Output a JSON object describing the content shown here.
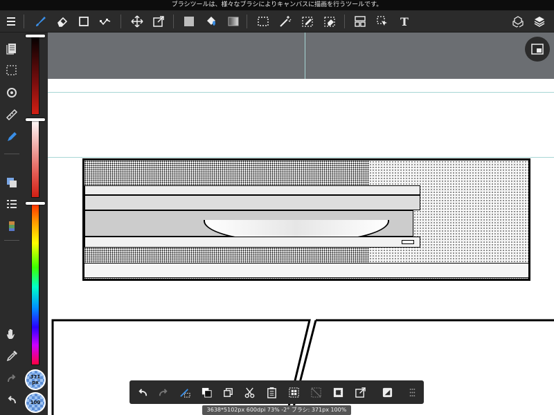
{
  "tip": "ブラシツールは、様々なブラシによりキャンバスに描画を行うツールです。",
  "toolbar": {
    "tools": [
      "menu-icon",
      "brush-icon",
      "eraser-icon",
      "shape-icon",
      "vector-icon",
      "move-icon",
      "transform-icon",
      "fill-color-icon",
      "bucket-icon",
      "gradient-icon",
      "select-rect-icon",
      "magic-wand-icon",
      "select-pen-icon",
      "select-eraser-icon",
      "panel-layout-icon",
      "select-move-icon",
      "text-icon",
      "3d-icon",
      "layers-icon"
    ],
    "text_tool_glyph": "T"
  },
  "leftbar": {
    "tools": [
      "pages-icon",
      "selection-icon",
      "snap-icon",
      "ruler-icon",
      "pen-icon",
      "color-layer-icon",
      "layer-list-icon",
      "material-icon",
      "hand-icon",
      "eyedropper-icon",
      "redo-icon",
      "undo-icon"
    ]
  },
  "brush": {
    "size": "371",
    "size_unit": "px",
    "opacity": "100"
  },
  "colors": {
    "accent": "#3a8ee6",
    "bar_bg": "#2b2b2b",
    "canvas_gray": "#6b6e72"
  },
  "floating_toolbar": {
    "items": [
      "undo-icon",
      "redo-icon",
      "transform-lasso-icon",
      "fill-layer-icon",
      "copy-layer-icon",
      "cut-icon",
      "paste-icon",
      "select-all-icon",
      "deselect-icon",
      "invert-select-icon",
      "transform-icon",
      "convert-icon",
      "more-icon"
    ]
  },
  "status": "3638*5102px 600dpi 73% -2° ブラシ: 371px 100%"
}
